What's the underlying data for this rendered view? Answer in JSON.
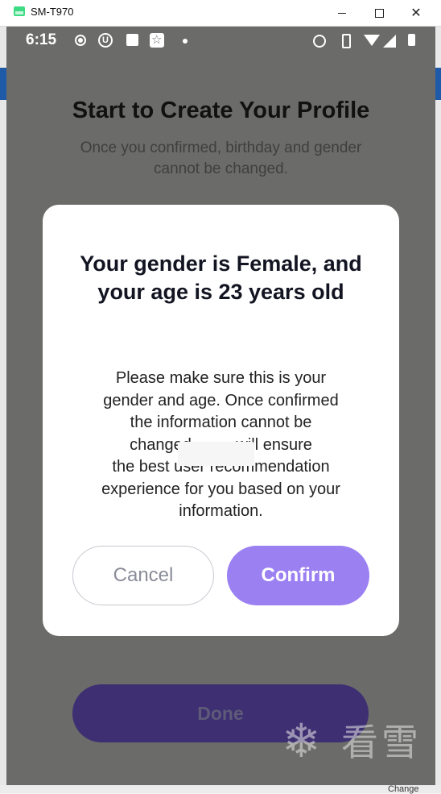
{
  "window": {
    "title": "SM-T970",
    "minimize_icon": "minimize-icon",
    "maximize_icon": "maximize-icon",
    "close_icon": "close-icon"
  },
  "host": {
    "bottom_right_text": "Change"
  },
  "status_bar": {
    "time": "6:15",
    "icons": [
      "record-icon",
      "u-icon",
      "square-icon",
      "star-badge-icon",
      "dot-icon",
      "alarm-icon",
      "vibrate-icon",
      "wifi-icon",
      "signal-icon",
      "battery-icon"
    ]
  },
  "page": {
    "title": "Start to Create Your Profile",
    "subtitle": "Once you confirmed, birthday and gender cannot be changed.",
    "done_label": "Done"
  },
  "dialog": {
    "title": "Your gender is Female, and your age is 23 years old",
    "body_lines": [
      "Please make sure this is your",
      "gender and age. Once confirmed",
      "the information cannot be",
      "changed          will ensure",
      "the best user recommendation",
      "experience for you based on your",
      "information."
    ],
    "cancel_label": "Cancel",
    "confirm_label": "Confirm"
  },
  "watermark": {
    "icon": "snowflake-icon",
    "text": "看雪"
  },
  "colors": {
    "overlay": "#6b6b69",
    "dialog_bg": "#ffffff",
    "confirm_bg": "#9b80f2",
    "done_bg": "#3d2f72"
  }
}
